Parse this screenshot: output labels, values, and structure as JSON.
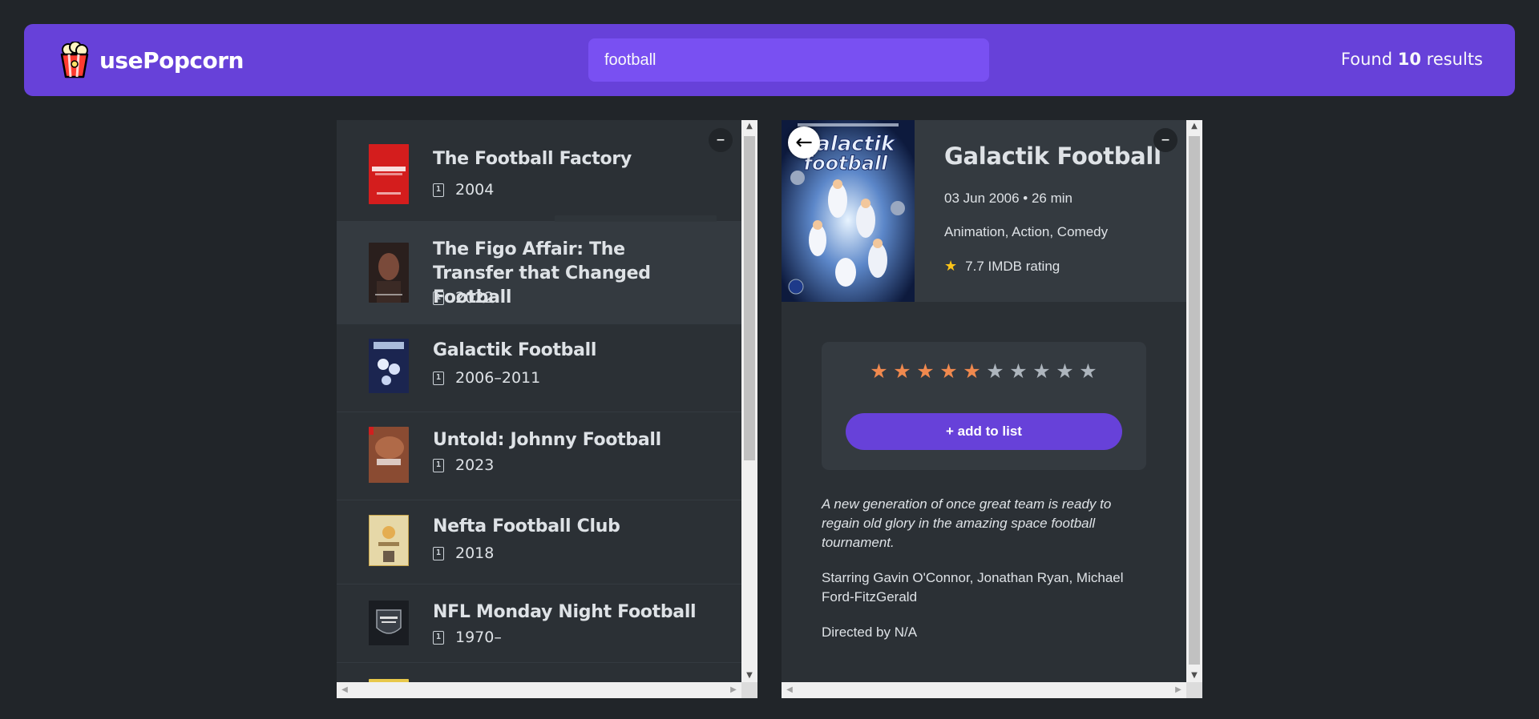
{
  "nav": {
    "app_name": "usePopcorn",
    "search_value": "football",
    "results_prefix": "Found ",
    "results_count": "10",
    "results_suffix": " results"
  },
  "list_box": {
    "toggle_label": "–",
    "movies": [
      {
        "title": "The Football Factory",
        "year": "2004",
        "icon": "calendar-icon",
        "poster_color": "#d41d1d"
      },
      {
        "title": "The Figo Affair: The Transfer that Changed Football",
        "year": "2022",
        "icon": "calendar-icon",
        "poster_color": "#3a2a26"
      },
      {
        "title": "Galactik Football",
        "year": "2006–2011",
        "icon": "calendar-icon",
        "poster_color": "#1b2550"
      },
      {
        "title": "Untold: Johnny Football",
        "year": "2023",
        "icon": "calendar-icon",
        "poster_color": "#8a4b32"
      },
      {
        "title": "Nefta Football Club",
        "year": "2018",
        "icon": "calendar-icon",
        "poster_color": "#e6d8a8"
      },
      {
        "title": "NFL Monday Night Football",
        "year": "1970–",
        "icon": "calendar-icon",
        "poster_color": "#1a1d22"
      }
    ]
  },
  "details": {
    "toggle_label": "–",
    "back_label": "←",
    "title": "Galactik Football",
    "released_runtime": "03 Jun 2006 • 26 min",
    "genre": "Animation, Action, Comedy",
    "imdb_rating": "7.7 IMDB rating",
    "user_rating": 5,
    "max_rating": 10,
    "add_button": "+ add to list",
    "plot": "A new generation of once great team is ready to regain old glory in the amazing space football tournament.",
    "starring": "Starring Gavin O'Connor, Jonathan Ryan, Michael Ford-FitzGerald",
    "directed": "Directed by N/A"
  },
  "colors": {
    "brand": "#6741d9",
    "search_bg": "#7950f2",
    "background": "#212529",
    "box_bg": "#2b3035",
    "star_on": "#f0894e",
    "star_yellow": "#fcc419"
  }
}
